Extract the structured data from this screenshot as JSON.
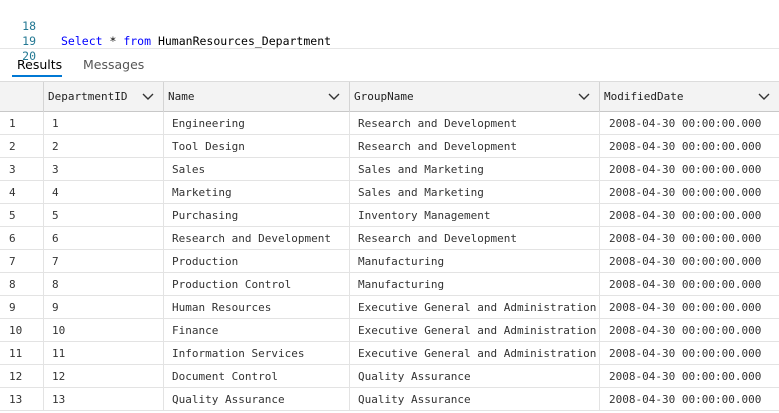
{
  "editor": {
    "lines": [
      {
        "num": "18",
        "kw1": "Select",
        "star": " * ",
        "kw2": "from",
        "rest": " HumanResources_Department"
      },
      {
        "num": "19"
      },
      {
        "num": "20"
      }
    ]
  },
  "tabs": {
    "results": "Results",
    "messages": "Messages",
    "active": "Results"
  },
  "grid": {
    "columns": [
      "DepartmentID",
      "Name",
      "GroupName",
      "ModifiedDate"
    ],
    "rows": [
      {
        "n": "1",
        "id": "1",
        "name": "Engineering",
        "group": "Research and Development",
        "date": "2008-04-30 00:00:00.000"
      },
      {
        "n": "2",
        "id": "2",
        "name": "Tool Design",
        "group": "Research and Development",
        "date": "2008-04-30 00:00:00.000"
      },
      {
        "n": "3",
        "id": "3",
        "name": "Sales",
        "group": "Sales and Marketing",
        "date": "2008-04-30 00:00:00.000"
      },
      {
        "n": "4",
        "id": "4",
        "name": "Marketing",
        "group": "Sales and Marketing",
        "date": "2008-04-30 00:00:00.000"
      },
      {
        "n": "5",
        "id": "5",
        "name": "Purchasing",
        "group": "Inventory Management",
        "date": "2008-04-30 00:00:00.000"
      },
      {
        "n": "6",
        "id": "6",
        "name": "Research and Development",
        "group": "Research and Development",
        "date": "2008-04-30 00:00:00.000"
      },
      {
        "n": "7",
        "id": "7",
        "name": "Production",
        "group": "Manufacturing",
        "date": "2008-04-30 00:00:00.000"
      },
      {
        "n": "8",
        "id": "8",
        "name": "Production Control",
        "group": "Manufacturing",
        "date": "2008-04-30 00:00:00.000"
      },
      {
        "n": "9",
        "id": "9",
        "name": "Human Resources",
        "group": "Executive General and Administration",
        "date": "2008-04-30 00:00:00.000"
      },
      {
        "n": "10",
        "id": "10",
        "name": "Finance",
        "group": "Executive General and Administration",
        "date": "2008-04-30 00:00:00.000"
      },
      {
        "n": "11",
        "id": "11",
        "name": "Information Services",
        "group": "Executive General and Administration",
        "date": "2008-04-30 00:00:00.000"
      },
      {
        "n": "12",
        "id": "12",
        "name": "Document Control",
        "group": "Quality Assurance",
        "date": "2008-04-30 00:00:00.000"
      },
      {
        "n": "13",
        "id": "13",
        "name": "Quality Assurance",
        "group": "Quality Assurance",
        "date": "2008-04-30 00:00:00.000"
      }
    ]
  },
  "icons": {
    "column_sort": "chevron-down-icon"
  },
  "colors": {
    "keyword": "#0000ff",
    "line_number": "#237893",
    "active_tab_underline": "#0078d4"
  }
}
